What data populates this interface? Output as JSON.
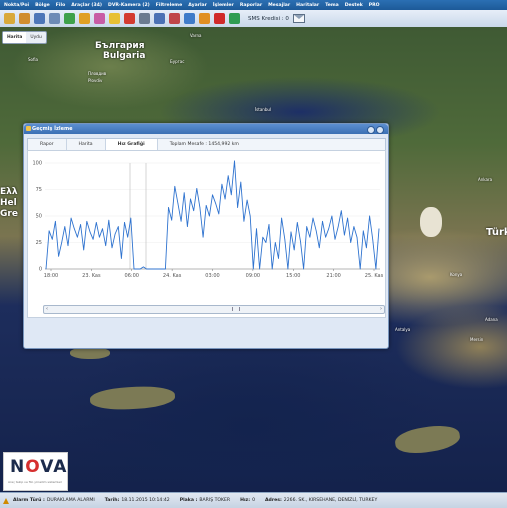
{
  "menu": [
    "Nokta/Poi",
    "Bölge",
    "Filo",
    "Araçlar (34)",
    "DVR-Kamera (2)",
    "Filtreleme",
    "Ayarlar",
    "İşlemler",
    "Raporlar",
    "Mesajlar",
    "Haritalar",
    "Tema",
    "Destek",
    "PRO"
  ],
  "toolbar": {
    "sms_text": "SMS Kredisi : 0",
    "icons": [
      {
        "name": "import-icon",
        "color": "#d9a93a"
      },
      {
        "name": "export-icon",
        "color": "#d08d2e"
      },
      {
        "name": "list-icon",
        "color": "#4c76b8"
      },
      {
        "name": "grid-icon",
        "color": "#6d8bb6"
      },
      {
        "name": "vehicle-icon",
        "color": "#3fa14b"
      },
      {
        "name": "route-icon",
        "color": "#e0a024"
      },
      {
        "name": "puzzle-icon",
        "color": "#c85ca5"
      },
      {
        "name": "send-icon",
        "color": "#e7c034"
      },
      {
        "name": "swap-icon",
        "color": "#d33b30"
      },
      {
        "name": "tools-icon",
        "color": "#6a7b90"
      },
      {
        "name": "user-icon",
        "color": "#4b71b4"
      },
      {
        "name": "chart-icon",
        "color": "#c0454a"
      },
      {
        "name": "shield-icon",
        "color": "#3e7bc9"
      },
      {
        "name": "timer-icon",
        "color": "#e08f23"
      },
      {
        "name": "power-icon",
        "color": "#d02a2a"
      },
      {
        "name": "globe-icon",
        "color": "#2f9d52"
      }
    ]
  },
  "map": {
    "tabs": [
      "Harita",
      "Uydu"
    ],
    "labels": [
      {
        "text": "България",
        "cls": "big"
      },
      {
        "text": "Bulgaria",
        "cls": "big"
      },
      {
        "text": "Türk",
        "cls": "big"
      },
      {
        "text": "Ελλ",
        "cls": "big"
      },
      {
        "text": "Hel",
        "cls": "big"
      },
      {
        "text": "Gre",
        "cls": "big"
      }
    ],
    "cities": [
      "Sofia",
      "Пловдив",
      "Plovdiv",
      "Бургас",
      "Varna",
      "İstanbul",
      "Konya",
      "Mersin",
      "Antalya",
      "Adana",
      "Ankara"
    ]
  },
  "dialog": {
    "title": "Geçmiş İzleme",
    "tabs": [
      "Rapor",
      "Harita",
      "Hız Grafiği",
      "Toplam Mesafe : 1454,992 km"
    ]
  },
  "chart_data": {
    "type": "line",
    "title": "",
    "xlabel": "",
    "ylabel": "",
    "ylim": [
      0,
      100
    ],
    "yticks": [
      0,
      25,
      50,
      75,
      100
    ],
    "xticks": [
      "18:00",
      "23. Kas",
      "06:00",
      "24. Kas",
      "03:00",
      "09:00",
      "15:00",
      "21:00",
      "25. Kas"
    ],
    "series": [
      {
        "values": [
          0,
          36,
          28,
          45,
          12,
          25,
          40,
          22,
          48,
          38,
          30,
          42,
          18,
          45,
          35,
          28,
          44,
          30,
          38,
          22,
          46,
          20,
          33,
          40,
          10,
          44,
          30,
          48,
          0,
          0,
          0,
          2,
          0,
          0,
          0,
          0,
          0,
          0,
          0,
          58,
          46,
          78,
          62,
          45,
          72,
          40,
          66,
          55,
          76,
          58,
          30,
          60,
          50,
          70,
          62,
          52,
          80,
          66,
          88,
          70,
          102,
          58,
          82,
          45,
          65,
          50,
          0,
          38,
          0,
          30,
          25,
          42,
          0,
          25,
          10,
          48,
          28,
          0,
          35,
          18,
          44,
          26,
          0,
          40,
          30,
          48,
          36,
          20,
          45,
          30,
          38,
          50,
          28,
          40,
          55,
          32,
          48,
          25,
          40,
          30,
          0,
          36,
          20,
          50,
          28,
          0,
          38
        ]
      }
    ]
  },
  "logo": {
    "brand_left": "N",
    "brand_o": "O",
    "brand_right": "VA",
    "tagline": "Araç takip ve filo yönetim sistemleri"
  },
  "status": {
    "alarm_label": "Alarm Türü :",
    "alarm_value": "DURAKLAMA ALARMI",
    "date_label": "Tarih:",
    "date_value": "18.11.2015 10:14:42",
    "plate_label": "Plaka :",
    "plate_value": "BARIŞ TOKER",
    "speed_label": "Hız:",
    "speed_value": "0",
    "address_label": "Adres:",
    "address_value": "2266. SK., KIRSEHANE, DENİZLİ, TURKEY"
  }
}
